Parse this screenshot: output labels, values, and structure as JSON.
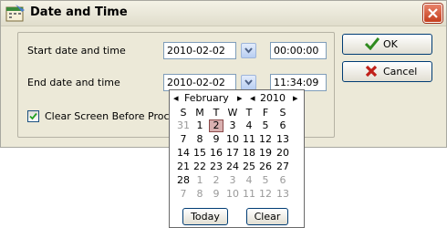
{
  "window": {
    "title": "Date and Time"
  },
  "form": {
    "start_label": "Start date and time",
    "start_date": "2010-02-02",
    "start_time": "00:00:00",
    "end_label": "End date and time",
    "end_date": "2010-02-02",
    "end_time": "11:34:09",
    "clear_label": "Clear Screen Before Proce",
    "clear_checked": true
  },
  "buttons": {
    "ok": "OK",
    "cancel": "Cancel"
  },
  "calendar": {
    "month": "February",
    "year": "2010",
    "weekdays": [
      "S",
      "M",
      "T",
      "W",
      "T",
      "F",
      "S"
    ],
    "weeks": [
      [
        "31",
        "1",
        "2",
        "3",
        "4",
        "5",
        "6"
      ],
      [
        "7",
        "8",
        "9",
        "10",
        "11",
        "12",
        "13"
      ],
      [
        "14",
        "15",
        "16",
        "17",
        "18",
        "19",
        "20"
      ],
      [
        "21",
        "22",
        "23",
        "24",
        "25",
        "26",
        "27"
      ],
      [
        "28",
        "1",
        "2",
        "3",
        "4",
        "5",
        "6"
      ],
      [
        "7",
        "8",
        "9",
        "10",
        "11",
        "12",
        "13"
      ]
    ],
    "selected_day": "2",
    "today_label": "Today",
    "clear_label": "Clear"
  },
  "colors": {
    "ok_check": "#2f8a1f",
    "cancel_x": "#c0201a",
    "selected_bg": "#d9b0b0"
  }
}
